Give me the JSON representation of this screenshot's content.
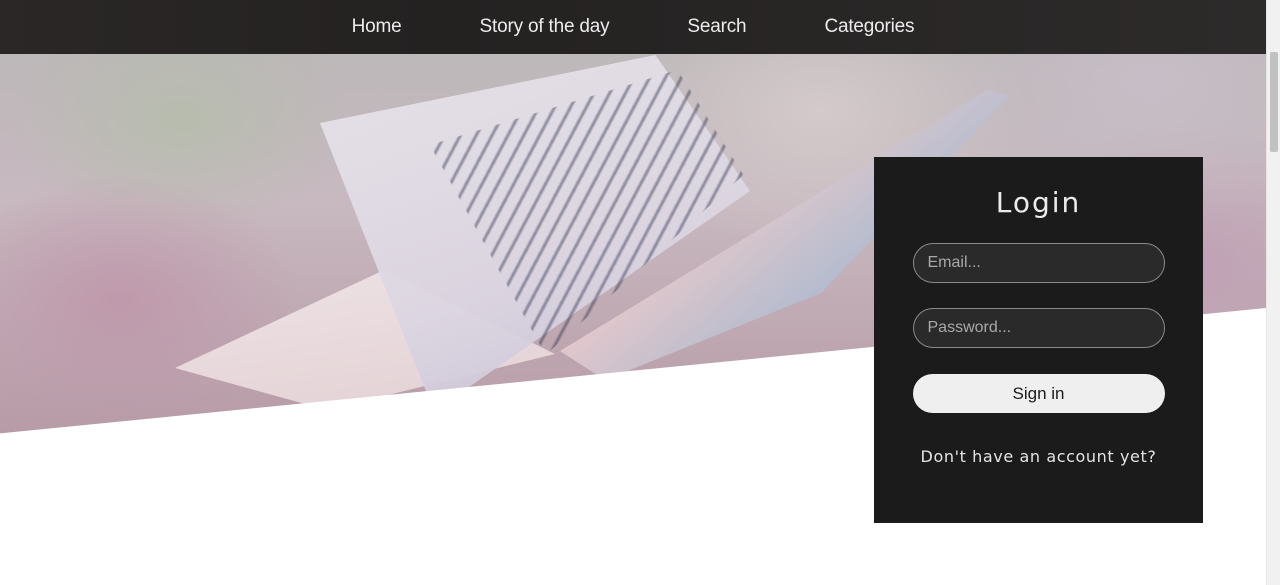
{
  "nav": {
    "items": [
      {
        "label": "Home"
      },
      {
        "label": "Story of the day"
      },
      {
        "label": "Search"
      },
      {
        "label": "Categories"
      }
    ]
  },
  "login": {
    "title": "Login",
    "email_placeholder": "Email...",
    "password_placeholder": "Password...",
    "signin_label": "Sign in",
    "register_link": "Don't have an account yet?"
  },
  "colors": {
    "navbar": "#242121",
    "panel": "#1c1b1b",
    "button": "#efefef"
  }
}
